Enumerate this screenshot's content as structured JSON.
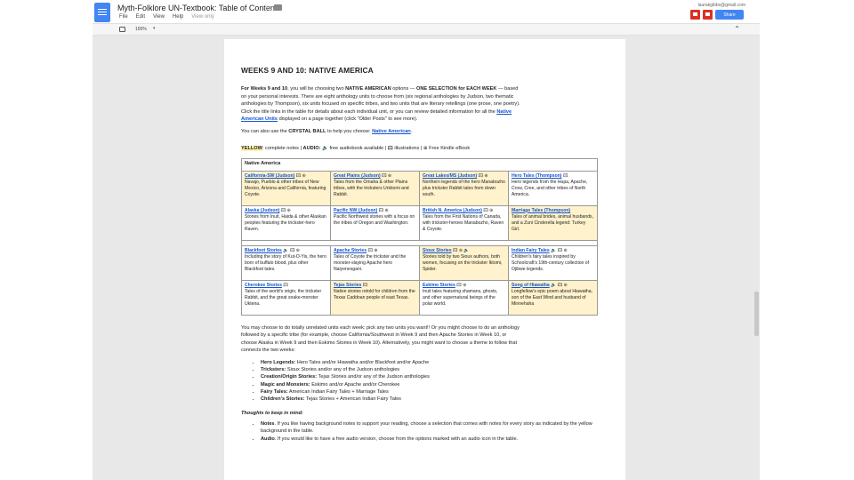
{
  "header": {
    "title": "Myth-Folklore UN-Textbook: Table of Contents",
    "menu": [
      "File",
      "Edit",
      "View",
      "Help"
    ],
    "view_only": "View only",
    "user": "laurakgibbs@gmail.com",
    "share_label": "Share",
    "zoom": "100%"
  },
  "doc": {
    "heading": "WEEKS 9 AND 10: NATIVE AMERICA",
    "intro": {
      "p1_a": "For Weeks 9 and 10",
      "p1_b": ", you will be choosing two ",
      "p1_c": "NATIVE AMERICAN",
      "p1_d": " options — ",
      "p1_e": "ONE SELECTION for EACH WEEK",
      "p1_f": " — based on your personal interests. There are eight anthology units to choose from (six regional anthologies by Judson, two thematic anthologies by Thompson), six units focused on specific tribes, and two units that are literary retellings (one prose, one poetry). Click the title links in the table for details about each individual unit, or you can review detailed information for all the ",
      "p1_link": "Native American Units",
      "p1_g": " displayed on a page together (click \"Older Posts\" to see more).",
      "p2_a": "You can also use the ",
      "p2_b": "CRYSTAL BALL",
      "p2_c": " to help you choose: ",
      "p2_link": "Native American",
      "p2_d": "."
    },
    "legend": {
      "yellow": "YELLOW",
      "rest_a": ": complete notes | ",
      "audio": "AUDIO:",
      "rest_b": " 🔈 free audiobook available | 🖾 illustrations | ⊕ Free Kindle eBook"
    },
    "table": {
      "header": "Native America",
      "rows": [
        [
          {
            "title": "California-SW (Judson)",
            "icons": "🖾 ⊕",
            "desc": "Navajo, Pueblo & other tribes of New Mexico, Arizona and California, featuring Coyote.",
            "hl": true
          },
          {
            "title": "Great Plains (Judson)",
            "icons": "🖾 ⊕",
            "desc": "Tales from the Omaha & other Plains tribes, with the tricksters Unktomi and Rabbit.",
            "hl": true
          },
          {
            "title": "Great Lakes/MS (Judson)",
            "icons": "🖾 ⊕",
            "desc": "Northern legends of the hero Manabozho plus trickster Rabbit tales from down south.",
            "hl": true
          },
          {
            "title": "Hero Tales (Thompson)",
            "icons": "🖾",
            "desc": "Hero legends from the Hupa, Apache, Crow, Cree, and other tribes of North America.",
            "hl": false
          }
        ],
        [
          {
            "title": "Alaska (Judson)",
            "icons": "🖾 ⊕",
            "desc": "Stories from Inuit, Haida & other Alaskan peoples featuring the trickster-hero Raven.",
            "hl": false
          },
          {
            "title": "Pacific NW (Judson)",
            "icons": "🖾 ⊕",
            "desc": "Pacific Northwest stories with a focus on the tribes of Oregon and Washington.",
            "hl": false
          },
          {
            "title": "British N. America (Judson)",
            "icons": "🖾 ⊕",
            "desc": "Tales from the First Nations of Canada, with trickster-heroes Manabozho, Raven & Coyote.",
            "hl": false
          },
          {
            "title": "Marriage Tales (Thompson)",
            "icons": "",
            "desc": "Tales of animal brides, animal husbands, and a Zuni Cinderella legend: Turkey Girl.",
            "hl": true
          }
        ],
        [
          {
            "title": "Blackfoot Stories",
            "icons": "🔈 🖾 ⊕",
            "desc": "Including the story of Kut-O-Yis, the hero born of buffalo blood, plus other Blackfoot tales.",
            "hl": false
          },
          {
            "title": "Apache Stories",
            "icons": "🖾 ⊕",
            "desc": "Tales of Coyote the trickster and the monster-slaying Apache hero Naiyenesgani.",
            "hl": false
          },
          {
            "title": "Sioux Stories",
            "icons": "🖾 ⊕ 🔈",
            "desc": "Stories told by two Sioux authors, both women, focusing on the trickster Iktomi, Spider.",
            "hl": true
          },
          {
            "title": "Indian Fairy Tales",
            "icons": "🔈 🖾 ⊕",
            "desc": "Children's fairy tales inspired by Schoolcraft's 19th-century collection of Ojibwe legends.",
            "hl": false
          }
        ],
        [
          {
            "title": "Cherokee Stories",
            "icons": "🖾",
            "desc": "Tales of the world's origin, the trickster Rabbit, and the great snake-monster Uktena.",
            "hl": false
          },
          {
            "title": "Tejas Stories",
            "icons": "🖾",
            "desc": "Native stories retold for children from the Texas Caddoan people of east Texas.",
            "hl": true
          },
          {
            "title": "Eskimo Stories",
            "icons": "🖾 ⊕",
            "desc": "Inuit tales featuring shamans, ghosts, and other supernatural beings of the polar world.",
            "hl": false
          },
          {
            "title": "Song of Hiawatha",
            "icons": "🔈 🖾 ⊕",
            "desc": "Longfellow's epic poem about Hiawatha, son of the East Wind and husband of Minnehaha",
            "hl": true
          }
        ]
      ]
    },
    "after_p": "You may choose to do totally unrelated units each week: pick any two units you want!! Or you might choose to do an anthology followed by a specific tribe (for example, choose California/Southwest in Week 9 and then Apache Stories in Week 10, or choose Alaska in Week 9 and then Eskimo Stories in Week 10). Alternatively, you might want to choose a theme to follow that connects the two weeks:",
    "themes": [
      {
        "label": "Hero Legends:",
        "text": " Hero Tales and/or Hiawatha and/or Blackfoot and/or Apache"
      },
      {
        "label": "Tricksters:",
        "text": " Sioux Stories and/or any of the Judson anthologies"
      },
      {
        "label": "Creation/Origin Stories:",
        "text": " Tejas Stories and/or any of the Judson anthologies"
      },
      {
        "label": "Magic and Monsters:",
        "text": " Eskimo and/or Apache and/or Cherokee"
      },
      {
        "label": "Fairy Tales:",
        "text": " American Indian Fairy Tales + Marriage Tales"
      },
      {
        "label": "Children's Stories:",
        "text": " Tejas Stories + American Indian Fairy Tales"
      }
    ],
    "thoughts_heading": "Thoughts to keep in mind:",
    "thoughts": [
      {
        "label": "Notes",
        "text": ". If you like having background notes to support your reading, choose a selection that comes with notes for every story as indicated by the yellow background in the table."
      },
      {
        "label": "Audio",
        "text": ". If you would like to have a free audio version, choose from the options marked with an audio icon in the table."
      }
    ]
  }
}
